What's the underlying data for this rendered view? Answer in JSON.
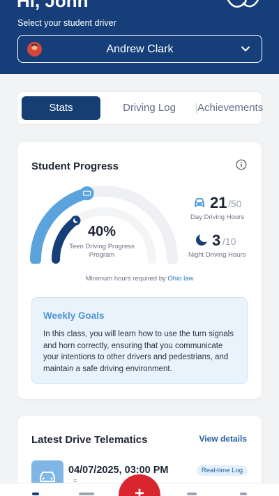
{
  "header": {
    "greeting": "Hi, John",
    "select_label": "Select your student driver",
    "selected_driver": "Andrew Clark",
    "logo_icon": "ohio-state-logo-icon"
  },
  "tabs": [
    {
      "label": "Stats",
      "active": true
    },
    {
      "label": "Driving Log",
      "active": false
    },
    {
      "label": "Achievements",
      "active": false
    }
  ],
  "progress": {
    "title": "Student Progress",
    "percent_text": "40%",
    "percent_value": 0.4,
    "caption": "Teen Driving Progress Program",
    "day": {
      "value": "21",
      "total": "/50",
      "label": "Day Driving Hours",
      "fraction": 0.42
    },
    "night": {
      "value": "3",
      "total": "/10",
      "label": "Night Driving Hours",
      "fraction": 0.3
    },
    "law_note": "Minimum hours required by",
    "law_link": "Ohio law"
  },
  "weekly_goals": {
    "title": "Weekly Goals",
    "text": "In this class, you will learn how to use the turn signals and horn correctly, ensuring that you communicate your intentions to other drivers and pedestrians, and maintain a safe driving environment."
  },
  "telematics": {
    "title": "Latest Drive Telematics",
    "link": "View details",
    "date": "04/07/2025, 03:00 PM",
    "sub": "=",
    "badge": "Real-time Log"
  },
  "fab": {
    "label": "+"
  },
  "colors": {
    "header": "#163f7a",
    "active_tab": "#153e75",
    "gauge_outer": "#5aa3dd",
    "gauge_inner": "#163f7a",
    "fab": "#d9252e",
    "link": "#2a76c8"
  }
}
